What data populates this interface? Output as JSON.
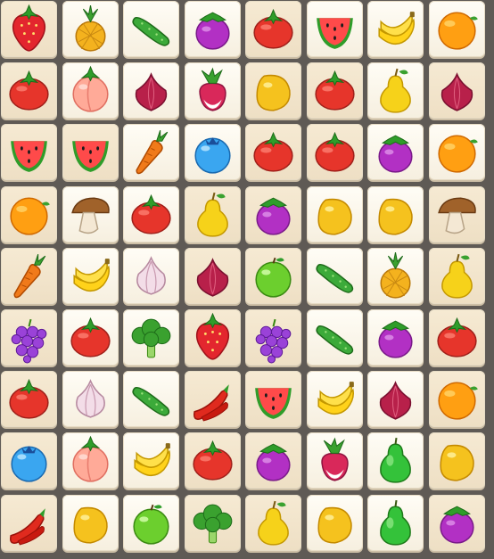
{
  "board": {
    "rows": 9,
    "cols": 8,
    "grid": [
      [
        "strawberry",
        "pineapple",
        "cucumber",
        "eggplant",
        "tomato",
        "watermelon",
        "banana",
        "orange"
      ],
      [
        "tomato",
        "peach",
        "onion",
        "radish",
        "mango",
        "tomato",
        "pear",
        "onion"
      ],
      [
        "watermelon",
        "watermelon",
        "carrot",
        "blueberry",
        "tomato",
        "tomato",
        "eggplant",
        "orange"
      ],
      [
        "orange",
        "mushroom",
        "tomato",
        "pear",
        "eggplant",
        "mango",
        "mango",
        "mushroom"
      ],
      [
        "carrot",
        "banana",
        "garlic",
        "onion",
        "apple",
        "cucumber",
        "pineapple",
        "pear"
      ],
      [
        "grapes",
        "tomato",
        "broccoli",
        "strawberry",
        "grapes",
        "cucumber",
        "eggplant",
        "tomato"
      ],
      [
        "tomato",
        "garlic",
        "cucumber",
        "chili",
        "watermelon",
        "banana",
        "onion",
        "orange"
      ],
      [
        "blueberry",
        "peach",
        "banana",
        "tomato",
        "eggplant",
        "radish",
        "green-pear",
        "mango"
      ],
      [
        "chili",
        "mango",
        "apple",
        "broccoli",
        "pear",
        "mango",
        "green-pear",
        "eggplant"
      ]
    ]
  }
}
